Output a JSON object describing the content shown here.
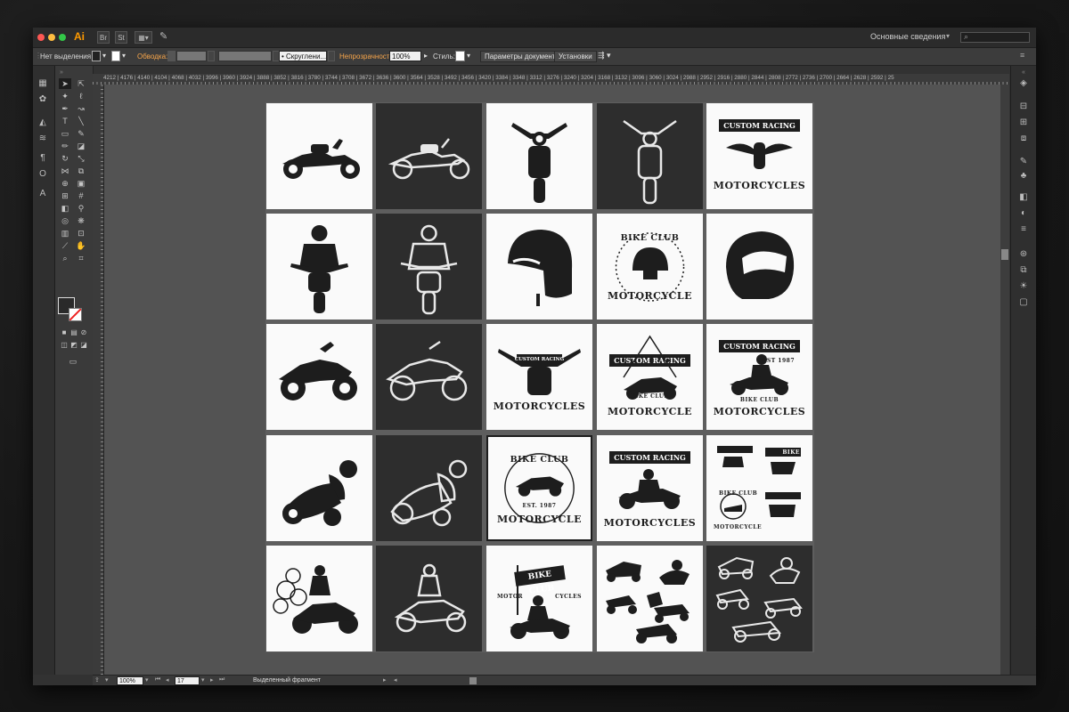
{
  "app": {
    "icon_text": "Ai",
    "workspace": "Основные сведения",
    "tab_labels": [
      "Br",
      "St"
    ]
  },
  "control_bar": {
    "selection": "Нет выделения",
    "stroke_label": "Обводка:",
    "brush": "Скруглени...",
    "opacity_label": "Непрозрачность:",
    "opacity_value": "100%",
    "style_label": "Стиль:",
    "doc_settings": "Параметры документа",
    "preferences": "Установки"
  },
  "ruler": {
    "numbers": "4212 | 4176 | 4140 | 4104 | 4068 | 4032 | 3996 | 3960 | 3924 | 3888 | 3852 | 3816 | 3780 | 3744 | 3708 | 3672 | 3636 | 3600 | 3564 | 3528 | 3492 | 3456 | 3420 | 3384 | 3348 | 3312 | 3276 | 3240 | 3204 | 3168 | 3132 | 3096 | 3060 | 3024 | 2988 | 2952 | 2916 | 2880 | 2844 | 2808 | 2772 | 2736 | 2700 | 2664 | 2628 | 2592 | 25"
  },
  "status_bar": {
    "zoom": "100%",
    "artboard": "17",
    "info": "Выделенный фрагмент"
  },
  "tiles": {
    "t05": {
      "top": "CUSTOM RACING",
      "bottom": "MOTORCYCLES"
    },
    "t09": {
      "top": "BIKE CLUB",
      "bottom": "MOTORCYCLE"
    },
    "t13": {
      "top": "CUSTOM RACING",
      "bottom": "MOTORCYCLES"
    },
    "t14": {
      "top": "CUSTOM RACING",
      "est": "EST 1987",
      "sub": "BIKE CLUB",
      "bottom": "MOTORCYCLE"
    },
    "t15": {
      "top": "CUSTOM RACING",
      "est": "EST 1987",
      "sub": "BIKE CLUB",
      "bottom": "MOTORCYCLES"
    },
    "t18": {
      "top": "BIKE CLUB",
      "est": "EST. 1987",
      "bottom": "MOTORCYCLE"
    },
    "t19": {
      "top": "CUSTOM RACING",
      "bottom": "MOTORCYCLES"
    },
    "t20": {
      "top": "BIKE",
      "sub": "BIKE CLUB",
      "bottom": "MOTORCYCLE"
    },
    "t23": {
      "top": "BIKE CLUB",
      "left": "MOTOR",
      "right": "CYCLES"
    }
  },
  "colors": {
    "accent": "#f7a54a",
    "canvas": "#535353",
    "tile_dark": "#2d2d2d",
    "tile_light": "#fafafa"
  }
}
